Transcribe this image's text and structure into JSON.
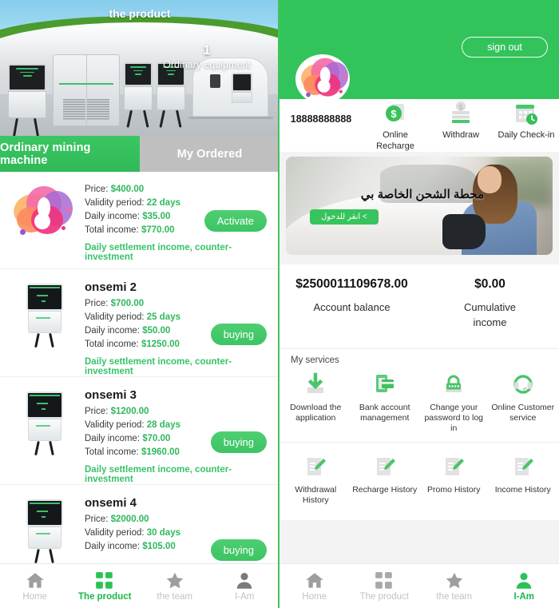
{
  "left": {
    "hero": {
      "title": "the product",
      "badge_number": "1",
      "badge_caption": "Ordinary equipment"
    },
    "tabs": [
      {
        "label": "Ordinary mining machine",
        "active": true
      },
      {
        "label": "My Ordered",
        "active": false
      }
    ],
    "labels": {
      "price": "Price:",
      "validity": "Validity period:",
      "daily": "Daily income:",
      "total": "Total income:",
      "note": "Daily settlement income, counter-investment"
    },
    "products": [
      {
        "name": "",
        "price": "$400.00",
        "validity": "22 days",
        "daily_income": "$35.00",
        "total_income": "$770.00",
        "button": "Activate",
        "note": "Daily settlement income, counter-investment",
        "icon": "brand-logo"
      },
      {
        "name": "onsemi 2",
        "price": "$700.00",
        "validity": "25 days",
        "daily_income": "$50.00",
        "total_income": "$1250.00",
        "button": "buying",
        "note": "Daily settlement income, counter-investment",
        "icon": "charger-thumb"
      },
      {
        "name": "onsemi 3",
        "price": "$1200.00",
        "validity": "28 days",
        "daily_income": "$70.00",
        "total_income": "$1960.00",
        "button": "buying",
        "note": "Daily settlement income, counter-investment",
        "icon": "charger-thumb"
      },
      {
        "name": "onsemi 4",
        "price": "$2000.00",
        "validity": "30 days",
        "daily_income": "$105.00",
        "total_income": "",
        "button": "buying",
        "note": "",
        "icon": "charger-thumb"
      }
    ],
    "nav": [
      {
        "label": "Home",
        "icon": "home-icon",
        "active": false
      },
      {
        "label": "The product",
        "icon": "grid-icon",
        "active": true
      },
      {
        "label": "the team",
        "icon": "star-icon",
        "active": false
      },
      {
        "label": "I-Am",
        "icon": "person-icon",
        "active": false
      }
    ]
  },
  "right": {
    "header": {
      "sign_out": "sign out",
      "phone": "18888888888"
    },
    "quick_actions": [
      {
        "label": "Online Recharge",
        "icon": "dollar-circle-icon"
      },
      {
        "label": "Withdraw",
        "icon": "coin-stack-icon"
      },
      {
        "label": "Daily Check-in",
        "icon": "calendar-clock-icon"
      }
    ],
    "banner": {
      "headline": "محطة الشحن الخاصة بي",
      "cta": "> انقر للدخول"
    },
    "balance": [
      {
        "amount": "$2500011109678.00",
        "label": "Account balance"
      },
      {
        "amount": "$0.00",
        "label": "Cumulative income"
      }
    ],
    "services": {
      "title": "My services",
      "row1": [
        {
          "label": "Download the application",
          "icon": "download-icon"
        },
        {
          "label": "Bank account management",
          "icon": "bank-card-icon"
        },
        {
          "label": "Change your password to log in",
          "icon": "lock-icon"
        },
        {
          "label": "Online Customer service",
          "icon": "headset-icon"
        }
      ],
      "row2": [
        {
          "label": "Withdrawal History",
          "icon": "document-edit-icon"
        },
        {
          "label": "Recharge History",
          "icon": "document-edit-icon"
        },
        {
          "label": "Promo History",
          "icon": "document-edit-icon"
        },
        {
          "label": "Income History",
          "icon": "document-edit-icon"
        }
      ]
    },
    "nav": [
      {
        "label": "Home",
        "icon": "home-icon",
        "active": false
      },
      {
        "label": "The product",
        "icon": "grid-icon",
        "active": false
      },
      {
        "label": "the team",
        "icon": "star-icon",
        "active": false
      },
      {
        "label": "I-Am",
        "icon": "person-icon",
        "active": true
      }
    ]
  },
  "colors": {
    "brand_green": "#33c35b",
    "button_green": "#3cc463",
    "note_green": "#37c36a",
    "value_green": "#2eb85c",
    "nav_inactive": "#c2c2c2",
    "nav_active": "#17b84a",
    "tab_inactive": "#bfbfbf"
  }
}
